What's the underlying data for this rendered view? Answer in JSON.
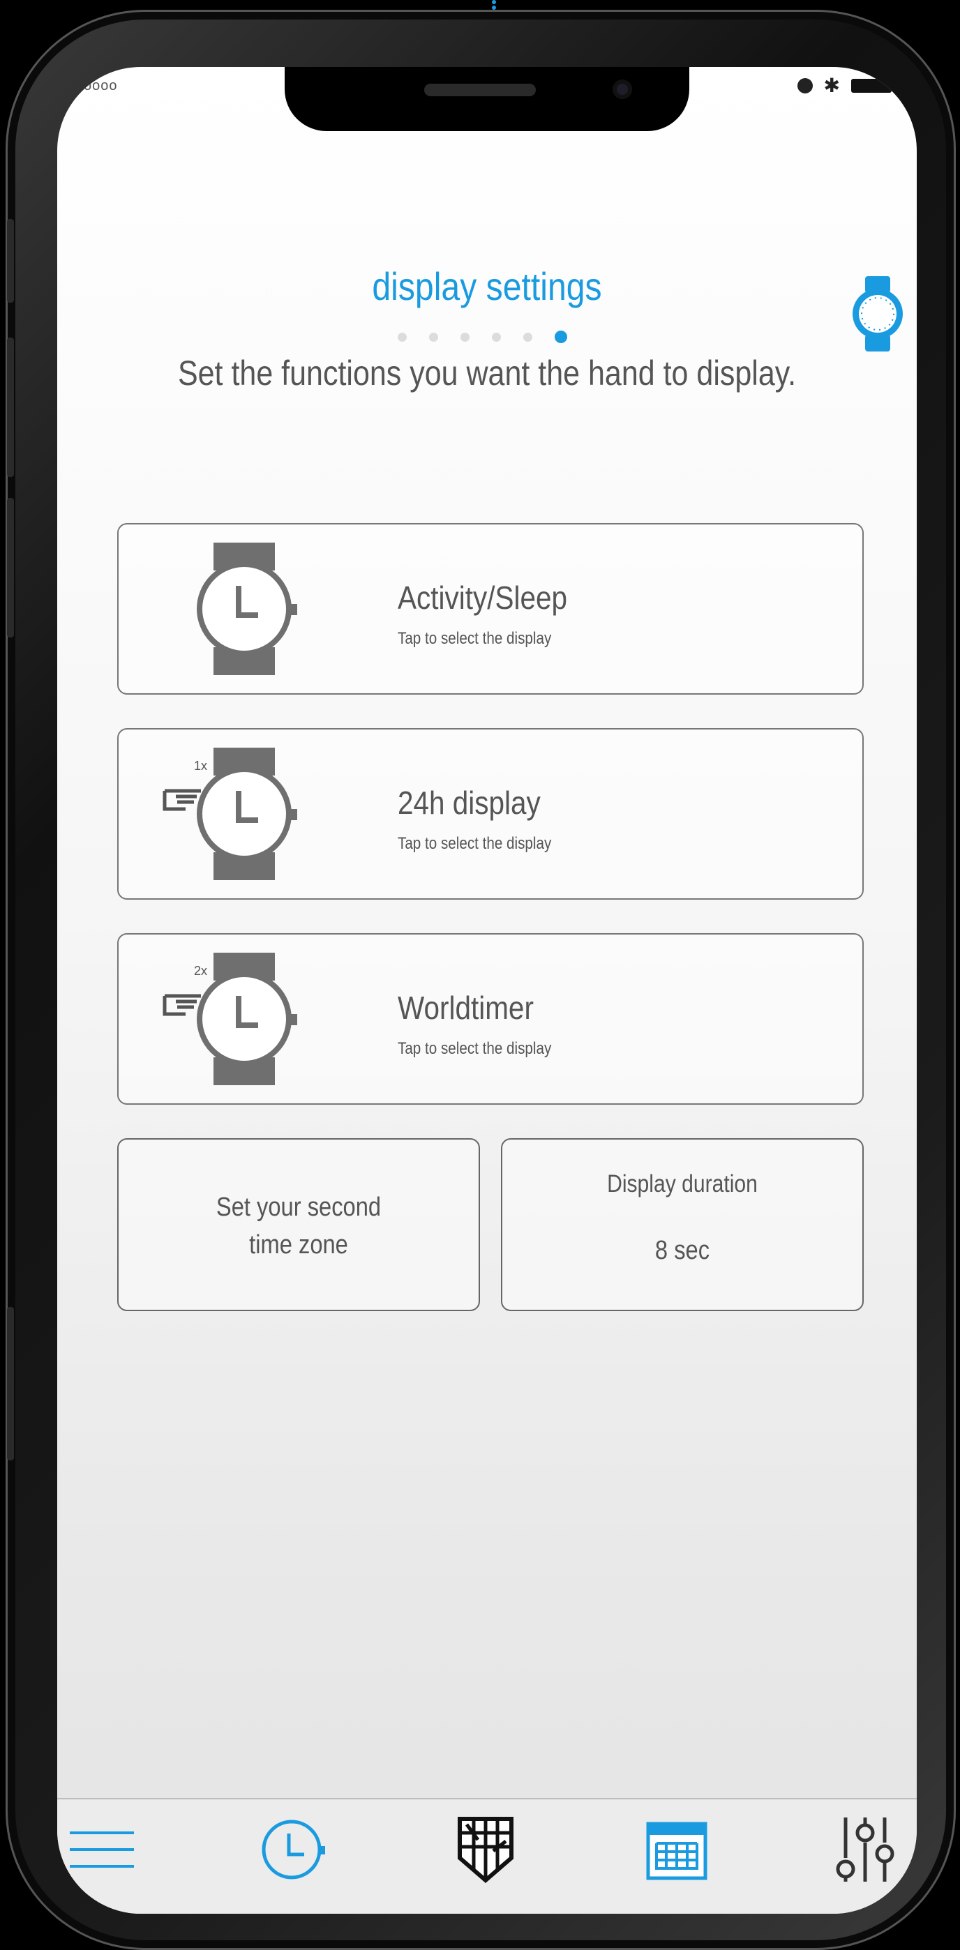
{
  "status_bar": {
    "signal": "oooo"
  },
  "header": {
    "title": "display settings",
    "step_count": 6,
    "active_step": 6,
    "subtitle": "Set the functions you want the hand to display."
  },
  "options": [
    {
      "title": "Activity/Sleep",
      "hint": "Tap to select the display",
      "press_label": ""
    },
    {
      "title": "24h display",
      "hint": "Tap to select the display",
      "press_label": "1x"
    },
    {
      "title": "Worldtimer",
      "hint": "Tap to select the display",
      "press_label": "2x"
    }
  ],
  "second_time_zone": {
    "line1": "Set your second",
    "line2": "time zone"
  },
  "display_duration": {
    "label": "Display duration",
    "value": "8 sec"
  },
  "tabbar": {
    "items": [
      {
        "icon": "menu-icon"
      },
      {
        "icon": "clock-icon"
      },
      {
        "icon": "world-map-icon"
      },
      {
        "icon": "calendar-icon"
      },
      {
        "icon": "settings-sliders-icon"
      }
    ]
  },
  "colors": {
    "accent": "#1a9be0",
    "text": "#555555",
    "watch_gray": "#6f6f6f"
  }
}
